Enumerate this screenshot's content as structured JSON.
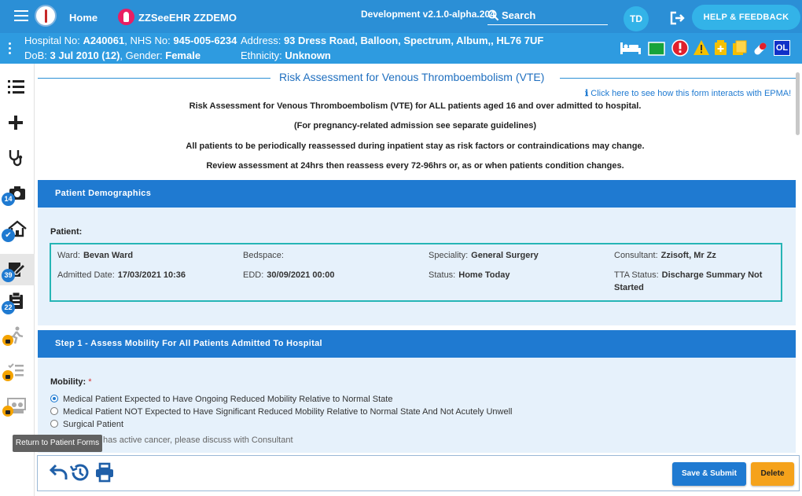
{
  "topbar": {
    "home_label": "Home",
    "patient_name": "ZZSeeEHR ZZDEMO",
    "version": "Development v2.1.0-alpha.204",
    "search_label": "Search",
    "user_initials": "TD",
    "help_label": "HELP & FEEDBACK"
  },
  "banner": {
    "hospital_label": "Hospital No:",
    "hospital_no": "A240061",
    "nhs_label": "NHS No:",
    "nhs_no": "945-005-6234",
    "address_label": "Address:",
    "address": "93 Dress Road, Balloon, Spectrum, Album,, HL76 7UF",
    "dob_label": "DoB:",
    "dob": "3 Jul 2010 (12)",
    "gender_label": "Gender:",
    "gender": "Female",
    "ethnicity_label": "Ethnicity:",
    "ethnicity": "Unknown",
    "ol_badge": "OL"
  },
  "sidebar": {
    "badges": {
      "item4": "14",
      "item7": "39",
      "item8": "22"
    },
    "tooltip": "Return to Patient Forms"
  },
  "form": {
    "title": "Risk Assessment for Venous Thromboembolism (VTE)",
    "epma_link": "Click here to see how this form interacts with EPMA!",
    "intro1": "Risk Assessment for Venous Thromboembolism (VTE) for ALL patients aged 16 and over admitted to hospital.",
    "intro2": "(For pregnancy-related admission see separate guidelines)",
    "intro3": "All patients to be periodically reassessed during inpatient stay as risk factors or contraindications may change.",
    "intro4": "Review assessment at 24hrs then reassess every 72-96hrs or, as or when patients condition changes."
  },
  "demographics": {
    "header": "Patient Demographics",
    "patient_label": "Patient:",
    "ward_label": "Ward:",
    "ward": "Bevan Ward",
    "bedspace_label": "Bedspace:",
    "speciality_label": "Speciality:",
    "speciality": "General Surgery",
    "consultant_label": "Consultant:",
    "consultant": "Zzisoft, Mr Zz",
    "admitted_label": "Admitted Date:",
    "admitted": "17/03/2021 10:36",
    "edd_label": "EDD:",
    "edd": "30/09/2021 00:00",
    "status_label": "Status:",
    "status": "Home Today",
    "tta_label": "TTA Status:",
    "tta_line1": "Discharge Summary Not",
    "tta_line2": "Started"
  },
  "step1": {
    "header": "Step 1 - Assess Mobility For All Patients Admitted To Hospital",
    "mobility_label": "Mobility:",
    "required_mark": "*",
    "options": [
      {
        "label": "Medical Patient Expected to Have Ongoing Reduced Mobility Relative to Normal State",
        "selected": true
      },
      {
        "label": "Medical Patient NOT Expected to Have Significant Reduced Mobility Relative to Normal State And Not Acutely Unwell",
        "selected": false
      },
      {
        "label": "Surgical Patient",
        "selected": false
      }
    ],
    "cancer_note": "has active cancer, please discuss with Consultant"
  },
  "footer": {
    "save_label": "Save & Submit",
    "delete_label": "Delete"
  },
  "colors": {
    "topbar": "#2b8fd6",
    "banner": "#2e9be0",
    "panel_header": "#1f7ad1",
    "panel_body": "#e6f1fb",
    "save": "#1f7ad1",
    "delete": "#f5a21b"
  }
}
